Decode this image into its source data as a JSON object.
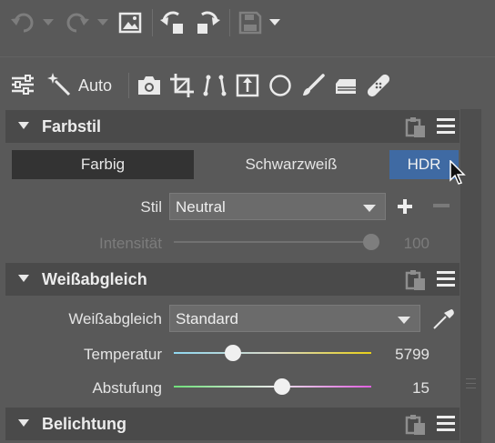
{
  "toolbar_top": {
    "undo_icon": "undo-icon",
    "redo_icon": "redo-icon",
    "image_icon": "image-icon",
    "rotate_left_icon": "rotate-left-icon",
    "rotate_right_icon": "rotate-right-icon",
    "save_icon": "save-icon"
  },
  "toolbar_tools": {
    "auto_label": "Auto"
  },
  "farbstil": {
    "title": "Farbstil",
    "modes": [
      "Farbig",
      "Schwarzweiß",
      "HDR"
    ],
    "active_mode": "Farbig",
    "selected_mode": "HDR",
    "stil_label": "Stil",
    "stil_value": "Neutral",
    "intensitaet_label": "Intensität",
    "intensitaet_value": "100",
    "intensitaet_level": 1.0
  },
  "weissabgleich": {
    "title": "Weißabgleich",
    "label": "Weißabgleich",
    "value": "Standard",
    "temperatur_label": "Temperatur",
    "temperatur_value": "5799",
    "temperatur_level": 0.3,
    "abstufung_label": "Abstufung",
    "abstufung_value": "15",
    "abstufung_level": 0.55
  },
  "belichtung": {
    "title": "Belichtung"
  },
  "colors": {
    "hdr_button": "#3f6aa3",
    "farbig_button": "#333333",
    "temperature_gradient_start": "#8fd8f0",
    "temperature_gradient_end": "#e8d018",
    "tint_gradient_start": "#6fe07a",
    "tint_gradient_end": "#e060e0"
  }
}
